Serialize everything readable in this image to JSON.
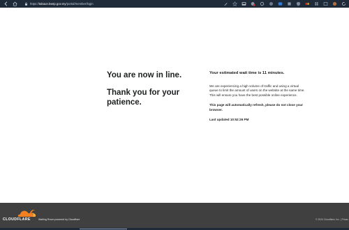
{
  "browser": {
    "url_prefix": "https://",
    "url_host": "takaun.kwsp.gov.my",
    "url_path": "/portal/member/login",
    "icons": [
      "back-icon",
      "home-icon",
      "lock-icon",
      "extensions-icon",
      "favorites-icon",
      "profile-icon"
    ]
  },
  "queue": {
    "line_heading": "You are now in line.",
    "thanks_heading": "Thank you for your patience.",
    "wait_text": "Your estimated wait time is 11 minutes.",
    "info_text": "We are experiencing a high volume of traffic and using a virtual queue to limit the amount of users on the website at the same time. This will ensure you have the best possible online experience.",
    "refresh_text": "This page will automatically refresh, please do not close your browser.",
    "updated_text": "Last updated 10:52:26 PM"
  },
  "footer": {
    "brand": "CLOUDFLARE",
    "powered_by": "Waiting Room powered by Cloudflare",
    "copyright": "© 2024 Cloudflare, Inc. | Privac"
  },
  "colors": {
    "chrome_bg": "#202b3a",
    "footer_bg": "#404041",
    "cloudflare_orange": "#f38020",
    "cloudflare_light": "#faae40",
    "text": "#1d1f20"
  }
}
